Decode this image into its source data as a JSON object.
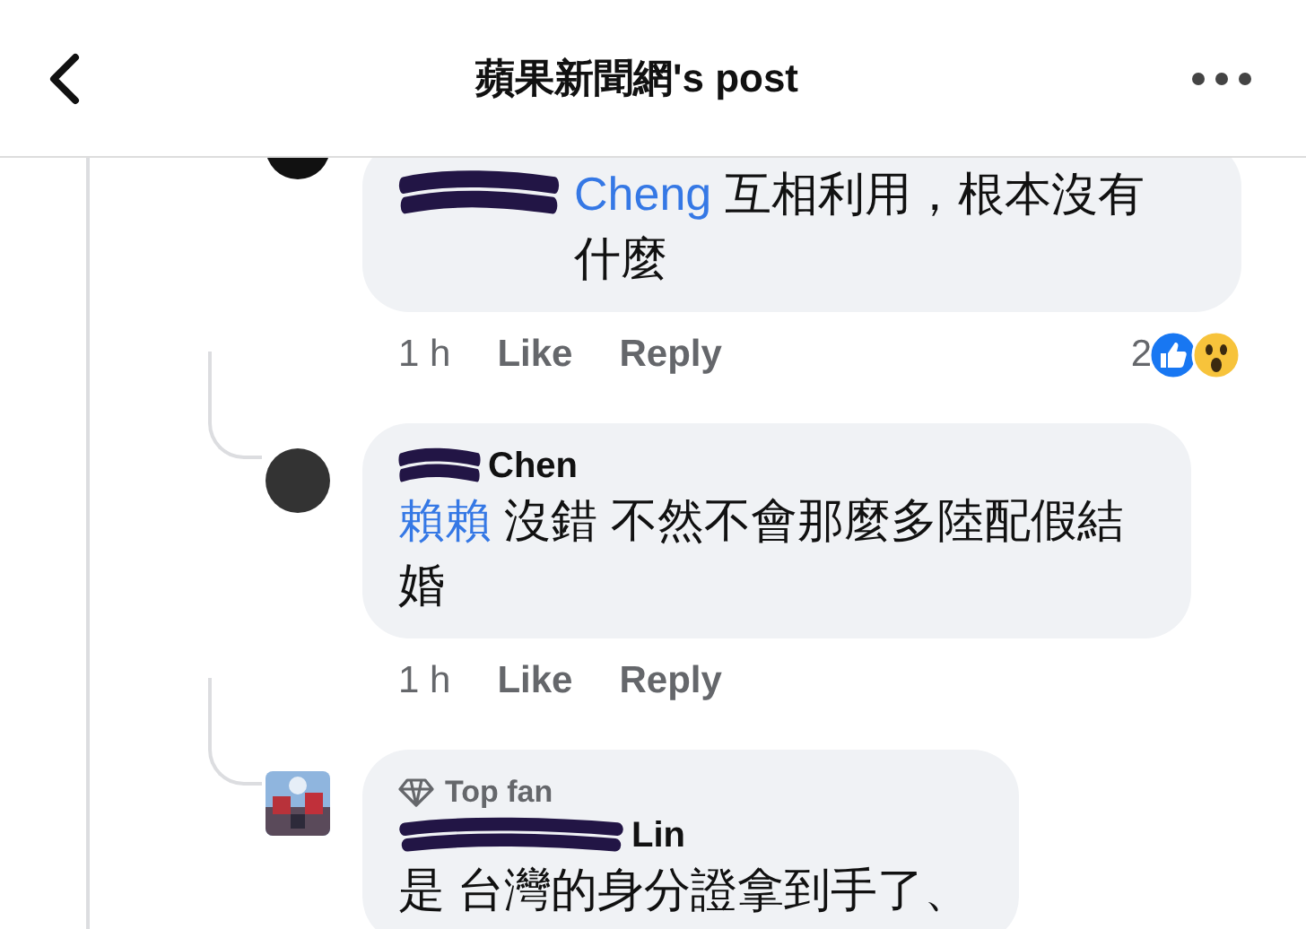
{
  "header": {
    "title": "蘋果新聞網's post"
  },
  "comments": [
    {
      "avatar": {
        "kind": "plain"
      },
      "redacted": true,
      "mention": "Cheng",
      "text": "互相利用，根本沒有什麼",
      "time": "1 h",
      "like": "Like",
      "reply": "Reply",
      "reaction_count": "2",
      "reactions": [
        {
          "kind": "like"
        },
        {
          "kind": "wow"
        }
      ]
    },
    {
      "avatar": {
        "kind": "plain"
      },
      "redacted": true,
      "author": "Chen",
      "mention": "賴賴",
      "text": "沒錯 不然不會那麼多陸配假結婚",
      "time": "1 h",
      "like": "Like",
      "reply": "Reply"
    },
    {
      "redacted": true,
      "badge": "Top fan",
      "author": "Lin",
      "text": "是 台灣的身分證拿到手了、"
    }
  ]
}
